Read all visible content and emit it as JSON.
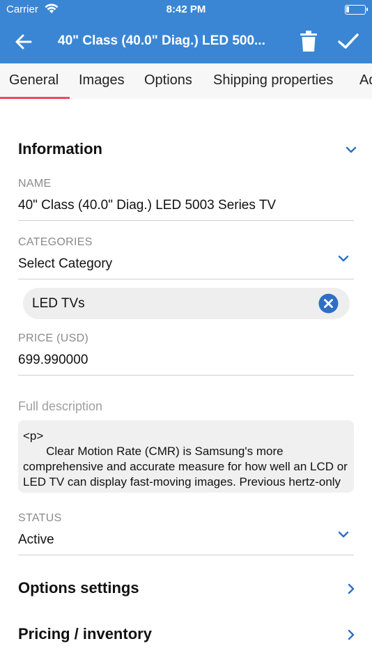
{
  "status_bar": {
    "carrier": "Carrier",
    "time": "8:42 PM",
    "battery_level": 0.15
  },
  "toolbar": {
    "title": "40\" Class (40.0\" Diag.) LED 500...",
    "back_icon": "arrow-left-icon",
    "delete_icon": "trash-icon",
    "save_icon": "checkmark-icon"
  },
  "tabs": [
    {
      "label": "General",
      "active": true
    },
    {
      "label": "Images",
      "active": false
    },
    {
      "label": "Options",
      "active": false
    },
    {
      "label": "Shipping properties",
      "active": false
    },
    {
      "label": "Ad",
      "active": false
    }
  ],
  "information": {
    "title": "Information",
    "name_label": "NAME",
    "name_value": "40\" Class (40.0\" Diag.) LED 5003 Series TV",
    "categories_label": "CATEGORIES",
    "categories_value": "Select Category",
    "category_chip": "LED TVs",
    "price_label": "PRICE (USD)",
    "price_value": "699.990000",
    "description_label": "Full description",
    "description_value": "<p>\n       Clear Motion Rate (CMR) is Samsung's more comprehensive and accurate measure for how well an LCD or LED TV can display fast-moving images. Previous hertz-only based claims only looked at how often the panel refreshes images.",
    "status_label": "STATUS",
    "status_value": "Active"
  },
  "sections": {
    "options_settings": "Options settings",
    "pricing_inventory": "Pricing / inventory"
  },
  "colors": {
    "header": "#3a86d4",
    "accent_blue": "#2d6fc4",
    "tab_indicator": "#e84a5f"
  }
}
